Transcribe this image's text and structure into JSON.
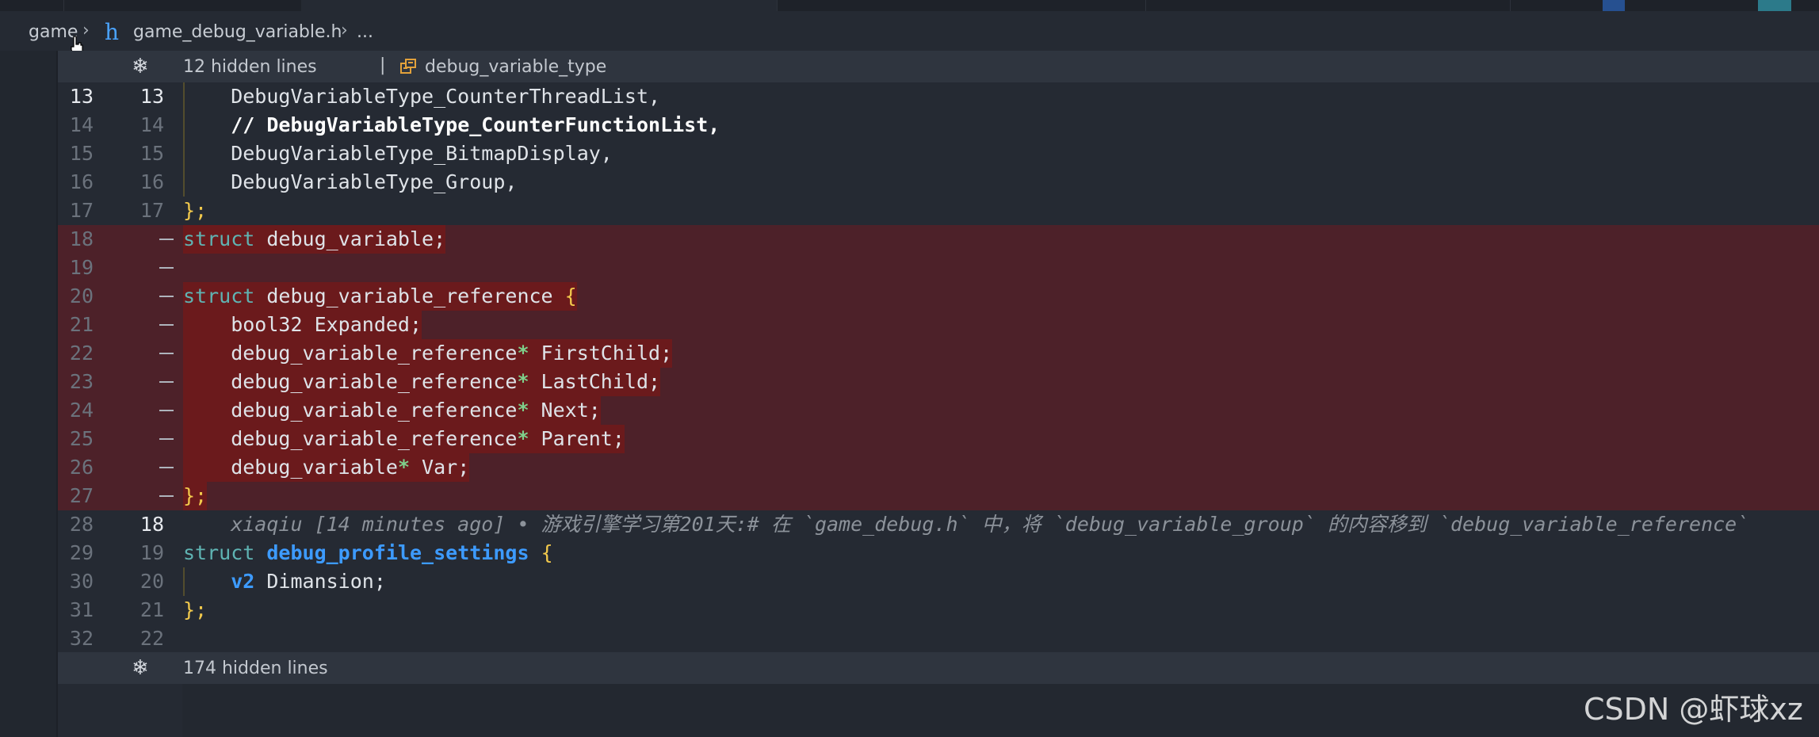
{
  "breadcrumb": {
    "folder": "game",
    "file": "game_debug_variable.h",
    "more": "..."
  },
  "top_fold": {
    "hidden_label": "12 hidden lines",
    "separator": "|",
    "symbol": "debug_variable_type"
  },
  "bottom_fold": {
    "hidden_label": "174 hidden lines"
  },
  "lines": {
    "l13": {
      "left": "13",
      "right": "13",
      "code": "    DebugVariableType_CounterThreadList,"
    },
    "l14": {
      "left": "14",
      "right": "14",
      "code": "// DebugVariableType_CounterFunctionList,"
    },
    "l15": {
      "left": "15",
      "right": "15",
      "code": "    DebugVariableType_BitmapDisplay,"
    },
    "l16": {
      "left": "16",
      "right": "16",
      "code": "    DebugVariableType_Group,"
    },
    "l17": {
      "left": "17",
      "right": "17",
      "code": "};"
    },
    "l18": {
      "left": "18",
      "t1": "struct",
      "t2": " debug_variable;"
    },
    "l19": {
      "left": "19"
    },
    "l20": {
      "left": "20",
      "t1": "struct",
      "t2": " debug_variable_reference ",
      "t3": "{"
    },
    "l21": {
      "left": "21",
      "code": "    bool32 Expanded;"
    },
    "l22": {
      "left": "22",
      "t1": "    debug_variable_reference",
      "star": "*",
      "t2": " FirstChild;"
    },
    "l23": {
      "left": "23",
      "t1": "    debug_variable_reference",
      "star": "*",
      "t2": " LastChild;"
    },
    "l24": {
      "left": "24",
      "t1": "    debug_variable_reference",
      "star": "*",
      "t2": " Next;"
    },
    "l25": {
      "left": "25",
      "t1": "    debug_variable_reference",
      "star": "*",
      "t2": " Parent;"
    },
    "l26": {
      "left": "26",
      "t1": "    debug_variable",
      "star": "*",
      "t2": " Var;"
    },
    "l27": {
      "left": "27",
      "code": "};"
    },
    "l28": {
      "left": "28",
      "right": "18",
      "blame": "    xiaqiu [14 minutes ago] • 游戏引擎学习第201天:# 在 `game_debug.h` 中，将 `debug_variable_group` 的内容移到 `debug_variable_reference`"
    },
    "l29": {
      "left": "29",
      "right": "19",
      "t1": "struct",
      "t2": "debug_profile_settings",
      "t3": "{"
    },
    "l30": {
      "left": "30",
      "right": "20",
      "t1": "v2",
      "t2": " Dimansion;"
    },
    "l31": {
      "left": "31",
      "right": "21",
      "code": "};"
    },
    "l32": {
      "left": "32",
      "right": "22"
    }
  },
  "watermark": "CSDN @虾球xz",
  "colors": {
    "deleted_bg": "#4d2129",
    "deleted_highlight": "#6b1a1c",
    "keyword": "#5fb4b3",
    "type_bold": "#3d9bff",
    "brace": "#f2c94c"
  }
}
